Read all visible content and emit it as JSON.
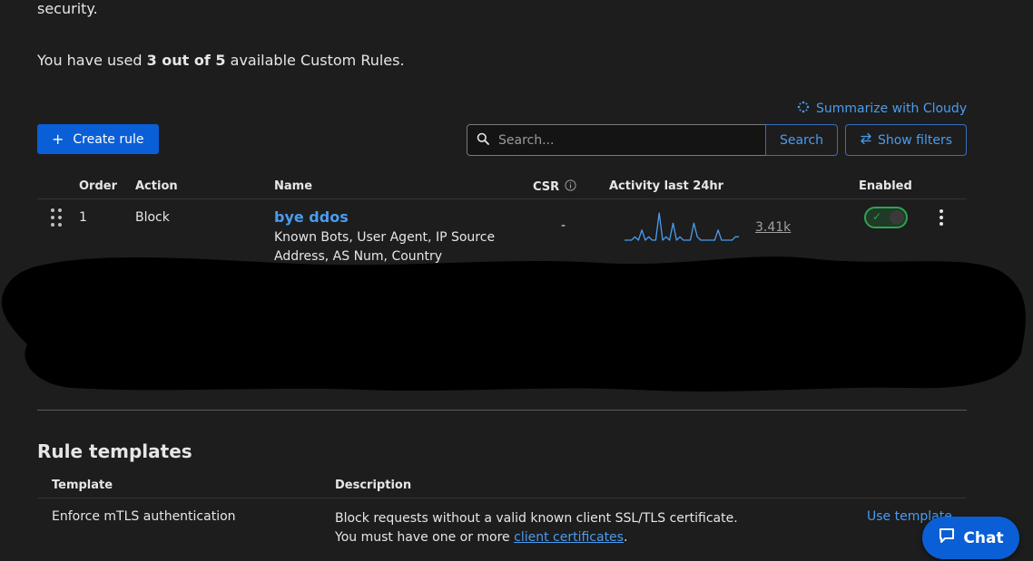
{
  "intro": {
    "tail_text": "security.",
    "usage_prefix": "You have used ",
    "usage_count": "3 out of 5",
    "usage_suffix": " available Custom Rules."
  },
  "toolbar": {
    "summarize_label": "Summarize with Cloudy",
    "create_label": "Create rule",
    "search_placeholder": "Search...",
    "search_button": "Search",
    "filters_label": "Show filters"
  },
  "rules_table": {
    "headers": {
      "order": "Order",
      "action": "Action",
      "name": "Name",
      "csr": "CSR",
      "activity": "Activity last 24hr",
      "enabled": "Enabled"
    },
    "rows": [
      {
        "order": "1",
        "action": "Block",
        "name": "bye ddos",
        "description": "Known Bots, User Agent, IP Source Address, AS Num, Country",
        "csr": "-",
        "activity_count": "3.41k",
        "activity_series": [
          0,
          0,
          0,
          1,
          0,
          3,
          0,
          1,
          0,
          0,
          8,
          0,
          1,
          0,
          5,
          0,
          1,
          0,
          0,
          0,
          5,
          1,
          0,
          0,
          0,
          0,
          0,
          3,
          0,
          0,
          0,
          0,
          1,
          1
        ],
        "enabled": true
      }
    ]
  },
  "templates": {
    "title": "Rule templates",
    "headers": {
      "template": "Template",
      "description": "Description"
    },
    "rows": [
      {
        "template": "Enforce mTLS authentication",
        "description_line1": "Block requests without a valid known client SSL/TLS certificate.",
        "description_line2_prefix": "You must have one or more ",
        "description_link": "client certificates",
        "description_line2_suffix": ".",
        "action": "Use template"
      }
    ]
  },
  "chat": {
    "label": "Chat"
  },
  "colors": {
    "accent": "#0a5fd6",
    "link": "#4a9cf0",
    "enabled": "#2ea44f",
    "background": "#1d1d1d"
  }
}
